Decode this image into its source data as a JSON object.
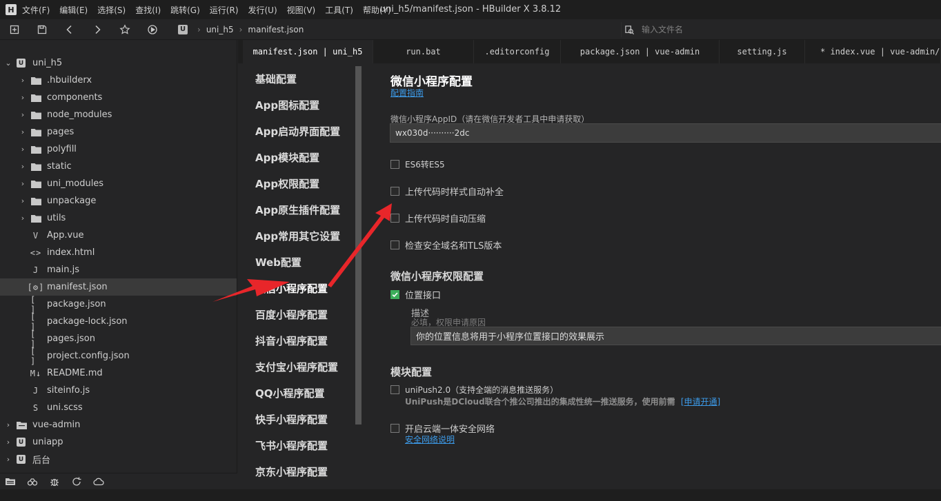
{
  "window": {
    "title": "uni_h5/manifest.json - HBuilder X 3.8.12",
    "logo": "H"
  },
  "menu": [
    "文件(F)",
    "编辑(E)",
    "选择(S)",
    "查找(I)",
    "跳转(G)",
    "运行(R)",
    "发行(U)",
    "视图(V)",
    "工具(T)",
    "帮助(Y)"
  ],
  "toolbar": {
    "icons": [
      "new-file-icon",
      "save-icon",
      "back-icon",
      "forward-icon",
      "star-icon",
      "run-icon"
    ],
    "breadcrumb": {
      "project_badge": "U",
      "project": "uni_h5",
      "file": "manifest.json"
    },
    "file_search_placeholder": "输入文件名"
  },
  "sidebar": {
    "rows": [
      {
        "label": "uni_h5",
        "kind": "project",
        "chev": "⌄",
        "indent": 0,
        "badge": "U"
      },
      {
        "label": ".hbuilderx",
        "kind": "folder",
        "chev": "›",
        "indent": 1
      },
      {
        "label": "components",
        "kind": "folder",
        "chev": "›",
        "indent": 1
      },
      {
        "label": "node_modules",
        "kind": "folder",
        "chev": "›",
        "indent": 1
      },
      {
        "label": "pages",
        "kind": "folder",
        "chev": "›",
        "indent": 1
      },
      {
        "label": "polyfill",
        "kind": "folder",
        "chev": "›",
        "indent": 1
      },
      {
        "label": "static",
        "kind": "folder",
        "chev": "›",
        "indent": 1
      },
      {
        "label": "uni_modules",
        "kind": "folder",
        "chev": "›",
        "indent": 1
      },
      {
        "label": "unpackage",
        "kind": "folder",
        "chev": "›",
        "indent": 1
      },
      {
        "label": "utils",
        "kind": "folder",
        "chev": "›",
        "indent": 1
      },
      {
        "label": "App.vue",
        "kind": "file",
        "glyph": "V",
        "indent": 1
      },
      {
        "label": "index.html",
        "kind": "file",
        "glyph": "<>",
        "indent": 1
      },
      {
        "label": "main.js",
        "kind": "file",
        "glyph": "J",
        "indent": 1
      },
      {
        "label": "manifest.json",
        "kind": "file",
        "glyph": "[⚙]",
        "indent": 1,
        "selected": true
      },
      {
        "label": "package.json",
        "kind": "file",
        "glyph": "[ ]",
        "indent": 1
      },
      {
        "label": "package-lock.json",
        "kind": "file",
        "glyph": "[ ]",
        "indent": 1
      },
      {
        "label": "pages.json",
        "kind": "file",
        "glyph": "[ ]",
        "indent": 1
      },
      {
        "label": "project.config.json",
        "kind": "file",
        "glyph": "[ ]",
        "indent": 1
      },
      {
        "label": "README.md",
        "kind": "file",
        "glyph": "M↓",
        "indent": 1
      },
      {
        "label": "siteinfo.js",
        "kind": "file",
        "glyph": "J",
        "indent": 1
      },
      {
        "label": "uni.scss",
        "kind": "file",
        "glyph": "S",
        "indent": 1
      },
      {
        "label": "vue-admin",
        "kind": "project-folder",
        "chev": "›",
        "indent": 0
      },
      {
        "label": "uniapp",
        "kind": "project",
        "chev": "›",
        "indent": 0,
        "badge": "U"
      },
      {
        "label": "后台",
        "kind": "project",
        "chev": "›",
        "indent": 0,
        "badge": "U"
      }
    ],
    "footer_icons": [
      "project-manager-icon",
      "plugin-icon",
      "debug-icon",
      "sync-icon",
      "cloud-icon"
    ]
  },
  "tabs": [
    {
      "label": "manifest.json | uni_h5",
      "active": true
    },
    {
      "label": "run.bat",
      "active": false
    },
    {
      "label": ".editorconfig",
      "active": false
    },
    {
      "label": "package.json | vue-admin",
      "active": false
    },
    {
      "label": "setting.js",
      "active": false
    },
    {
      "label": "* index.vue | vue-admin/",
      "active": false
    }
  ],
  "settings_nav": {
    "items": [
      "基础配置",
      "App图标配置",
      "App启动界面配置",
      "App模块配置",
      "App权限配置",
      "App原生插件配置",
      "App常用其它设置",
      "Web配置",
      "微信小程序配置",
      "百度小程序配置",
      "抖音小程序配置",
      "支付宝小程序配置",
      "QQ小程序配置",
      "快手小程序配置",
      "飞书小程序配置",
      "京东小程序配置"
    ],
    "current": "微信小程序配置"
  },
  "content": {
    "title": "微信小程序配置",
    "guide_link": "配置指南",
    "appid_label": "微信小程序AppID（请在微信开发者工具中申请获取）",
    "appid_value": "wx030d··········2dc",
    "checkboxes": [
      {
        "label": "ES6转ES5",
        "checked": false
      },
      {
        "label": "上传代码时样式自动补全",
        "checked": false
      },
      {
        "label": "上传代码时自动压缩",
        "checked": false
      },
      {
        "label": "检查安全域名和TLS版本",
        "checked": false
      }
    ],
    "permission_section": "微信小程序权限配置",
    "location": {
      "label": "位置接口",
      "checked": true,
      "desc_title": "描述",
      "desc_hint": "必填，权限申请原因",
      "desc_value": "你的位置信息将用于小程序位置接口的效果展示"
    },
    "module_section": "模块配置",
    "unipush": {
      "label": "uniPush2.0（支持全端的消息推送服务）",
      "checked": false,
      "desc": "UniPush是DCloud联合个推公司推出的集成性统一推送服务，使用前需",
      "desc_link": "[申请开通]"
    },
    "secure_network": {
      "label": "开启云端一体安全网络",
      "checked": false,
      "link": "安全网络说明"
    }
  },
  "colors": {
    "accent_link": "#3c9ae8",
    "checkbox_checked": "#3cae5b",
    "annotation_arrow": "#e8262a"
  }
}
